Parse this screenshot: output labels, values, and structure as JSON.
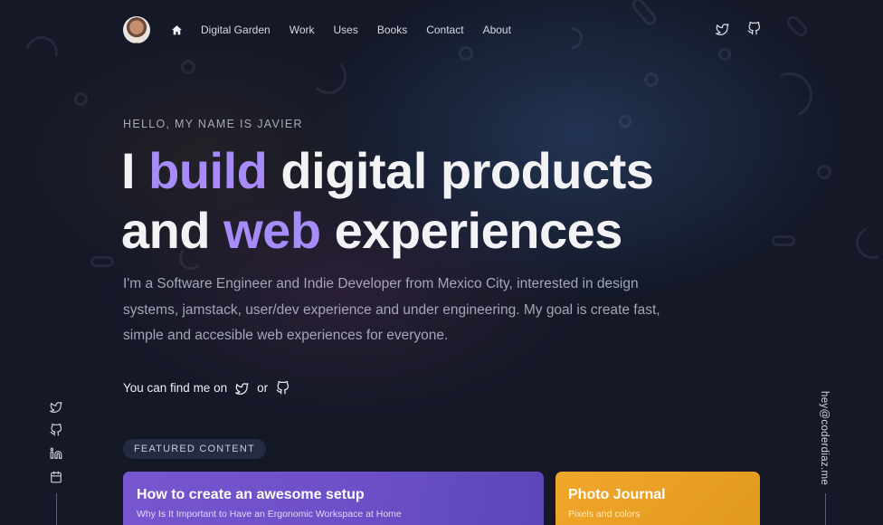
{
  "nav": {
    "links": [
      "Digital Garden",
      "Work",
      "Uses",
      "Books",
      "Contact",
      "About"
    ]
  },
  "hero": {
    "eyebrow": "HELLO, MY NAME IS JAVIER",
    "line1_a": "I ",
    "line1_accent": "build",
    "line1_b": " digital products",
    "line2_a": "and ",
    "line2_accent": "web",
    "line2_b": " experiences",
    "intro": "I'm a Software Engineer and Indie Developer from Mexico City, interested in design systems, jamstack, user/dev experience and under engineering. My goal is create fast, simple and accesible web experiences for everyone.",
    "find_me": "You can find me on",
    "or": "or"
  },
  "rail": {
    "email": "hey@coderdiaz.me"
  },
  "featured": {
    "badge": "FEATURED CONTENT",
    "cards": [
      {
        "title": "How to create an awesome setup",
        "subtitle": "Why Is It Important to Have an Ergonomic Workspace at Home"
      },
      {
        "title": "Photo Journal",
        "subtitle": "Pixels and colors"
      }
    ]
  },
  "colors": {
    "background": "#141827",
    "accent": "#a78bfa",
    "card_purple": "#7756cf",
    "card_orange": "#f0a72a"
  },
  "icons": [
    "home-icon",
    "twitter-icon",
    "github-icon",
    "linkedin-icon",
    "calendar-icon"
  ]
}
